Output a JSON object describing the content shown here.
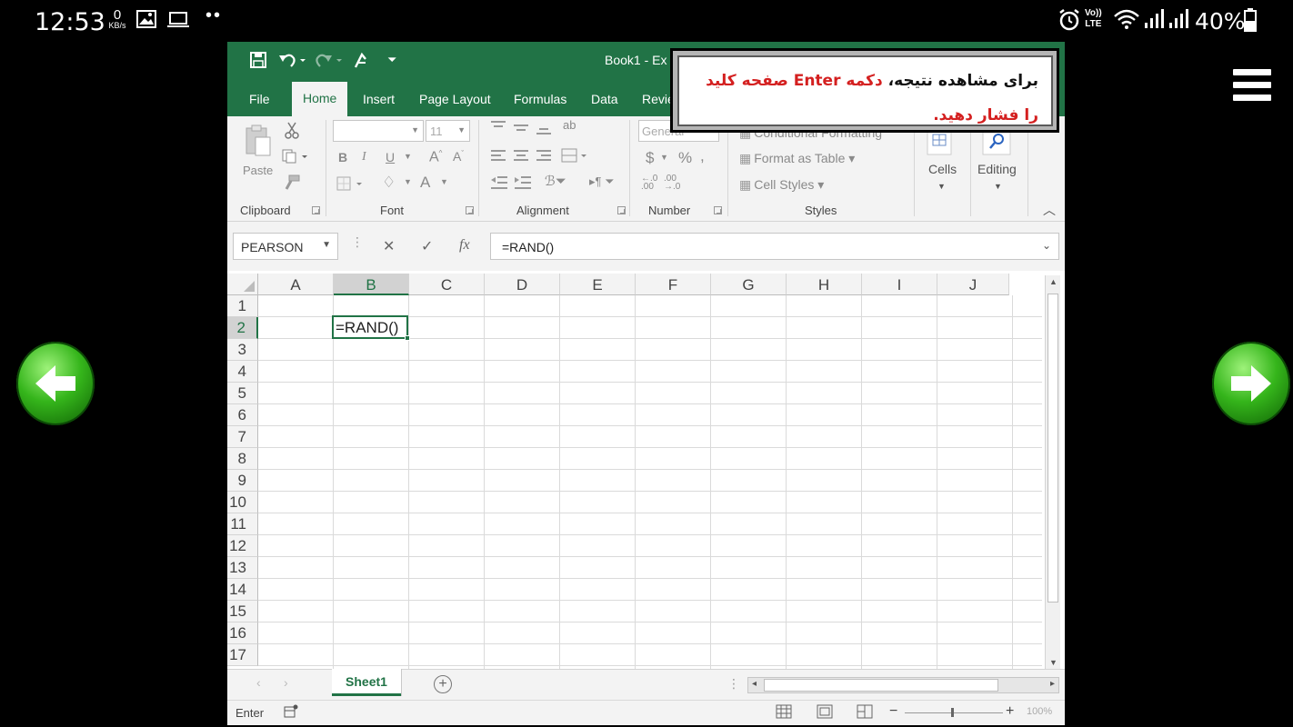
{
  "phone_status": {
    "time": "12:53",
    "net_speed": "0",
    "net_unit": "KB/s",
    "signal_label": "Vo)) LTE",
    "battery": "40%"
  },
  "excel": {
    "title": "Book1 - Ex",
    "ribbon_tabs": [
      "File",
      "Home",
      "Insert",
      "Page Layout",
      "Formulas",
      "Data",
      "Revie"
    ],
    "active_tab": "Home",
    "clipboard": {
      "paste": "Paste",
      "label": "Clipboard"
    },
    "font": {
      "name": "",
      "size": "11",
      "label": "Font"
    },
    "alignment": {
      "label": "Alignment"
    },
    "number": {
      "format": "General",
      "label": "Number"
    },
    "styles": {
      "conditional": "Conditional Formatting",
      "format_table": "Format as Table",
      "cell_styles": "Cell Styles",
      "label": "Styles"
    },
    "cells": {
      "label": "Cells"
    },
    "editing": {
      "label": "Editing"
    },
    "name_box": "PEARSON",
    "formula": "=RAND()",
    "columns": [
      "A",
      "B",
      "C",
      "D",
      "E",
      "F",
      "G",
      "H",
      "I",
      "J"
    ],
    "rows": [
      "1",
      "2",
      "3",
      "4",
      "5",
      "6",
      "7",
      "8",
      "9",
      "10",
      "11",
      "12",
      "13",
      "14",
      "15",
      "16",
      "17"
    ],
    "selected_column": "B",
    "selected_row": "2",
    "active_cell_text": "=RAND()",
    "sheet_tab": "Sheet1",
    "status_mode": "Enter",
    "zoom": "100%"
  },
  "hint": {
    "line1_black": "برای مشاهده نتیجه،",
    "line1_red_a": "دکمه",
    "enter": "Enter",
    "line1_red_b": "صفحه کلید",
    "line2_red": "را فشار دهید."
  }
}
